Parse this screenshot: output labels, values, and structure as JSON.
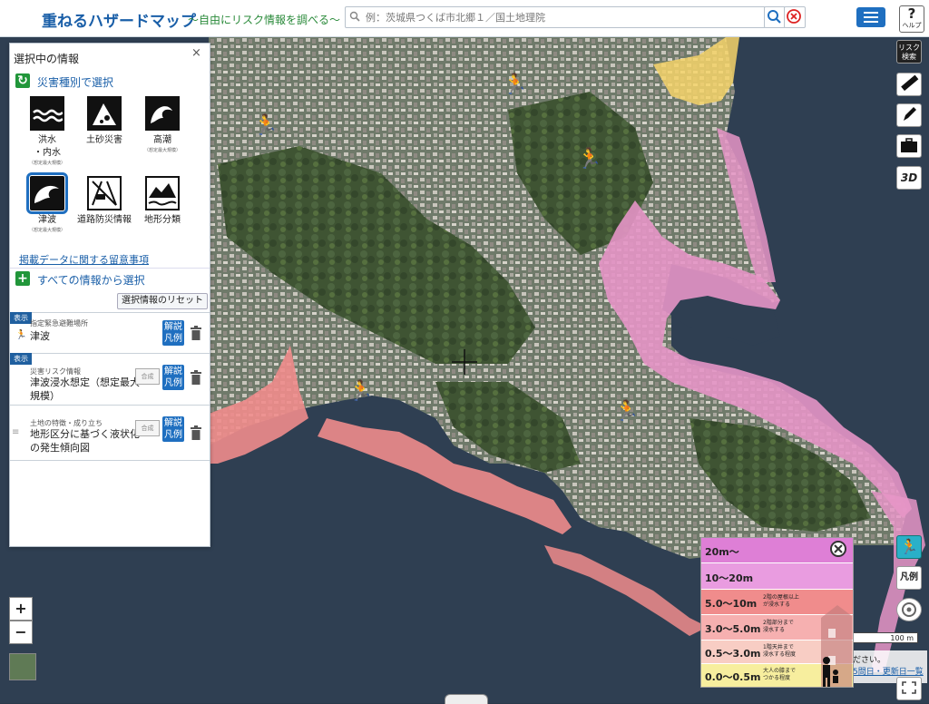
{
  "header": {
    "title": "重ねるハザードマップ",
    "subtitle": "～自由にリスク情報を調べる～",
    "search_placeholder": "例：茨城県つくば市北郷１／国土地理院",
    "help_label": "ヘルプ"
  },
  "panel": {
    "title": "選択中の情報",
    "close": "×",
    "by_hazard": "災害種別で選択",
    "hazards": [
      {
        "label": "洪水",
        "label2": "・内水",
        "note": "（想定最大規模）"
      },
      {
        "label": "土砂災害",
        "label2": "",
        "note": ""
      },
      {
        "label": "高潮",
        "label2": "",
        "note": "（想定最大規模）"
      },
      {
        "label": "津波",
        "label2": "",
        "note": "（想定最大規模）"
      },
      {
        "label": "道路防災情報",
        "label2": "",
        "note": ""
      },
      {
        "label": "地形分類",
        "label2": "",
        "note": ""
      }
    ],
    "notice_link": "掲載データに関する留意事項",
    "all_info": "すべての情報から選択",
    "reset": "選択情報のリセット",
    "layers": [
      {
        "badge": "表示",
        "category": "指定緊急避難場所",
        "name": "津波",
        "name2": "",
        "button": "解説",
        "button2": "凡例"
      },
      {
        "badge": "表示",
        "category": "災害リスク情報",
        "name": "津波浸水想定（想定最大",
        "name2": "規模）",
        "merge": "合成",
        "button": "解説",
        "button2": "凡例"
      },
      {
        "badge": "",
        "category": "土地の特徴・成り立ち",
        "name": "地形区分に基づく液状化",
        "name2": "の発生傾向図",
        "merge": "合成",
        "button": "解説",
        "button2": "凡例"
      }
    ]
  },
  "legend": {
    "rows": [
      {
        "range": "20m～",
        "desc": "",
        "desc2": "",
        "color": "#de7fd6"
      },
      {
        "range": "10～20m",
        "desc": "",
        "desc2": "",
        "color": "#e99ce0"
      },
      {
        "range": "5.0～10m",
        "desc": "2階の屋根以上",
        "desc2": "が浸水する",
        "color": "#f08c8c"
      },
      {
        "range": "3.0～5.0m",
        "desc": "2階部分まで",
        "desc2": "浸水する",
        "color": "#f6b0b0"
      },
      {
        "range": "0.5～3.0m",
        "desc": "1階天井まで",
        "desc2": "浸水する程度",
        "color": "#f8cdc4"
      },
      {
        "range": "0.0～0.5m",
        "desc": "大人の膝まで",
        "desc2": "つかる程度",
        "color": "#f7ee9e"
      }
    ]
  },
  "tools": {
    "risk_search": "リスク検索",
    "three_d": "3D",
    "legend_btn": "凡例"
  },
  "zoom": {
    "in": "+",
    "out": "−"
  },
  "map": {
    "scale": "100 m",
    "footer_text": "ださい。",
    "footer_link": "5問日・更新日一覧"
  }
}
